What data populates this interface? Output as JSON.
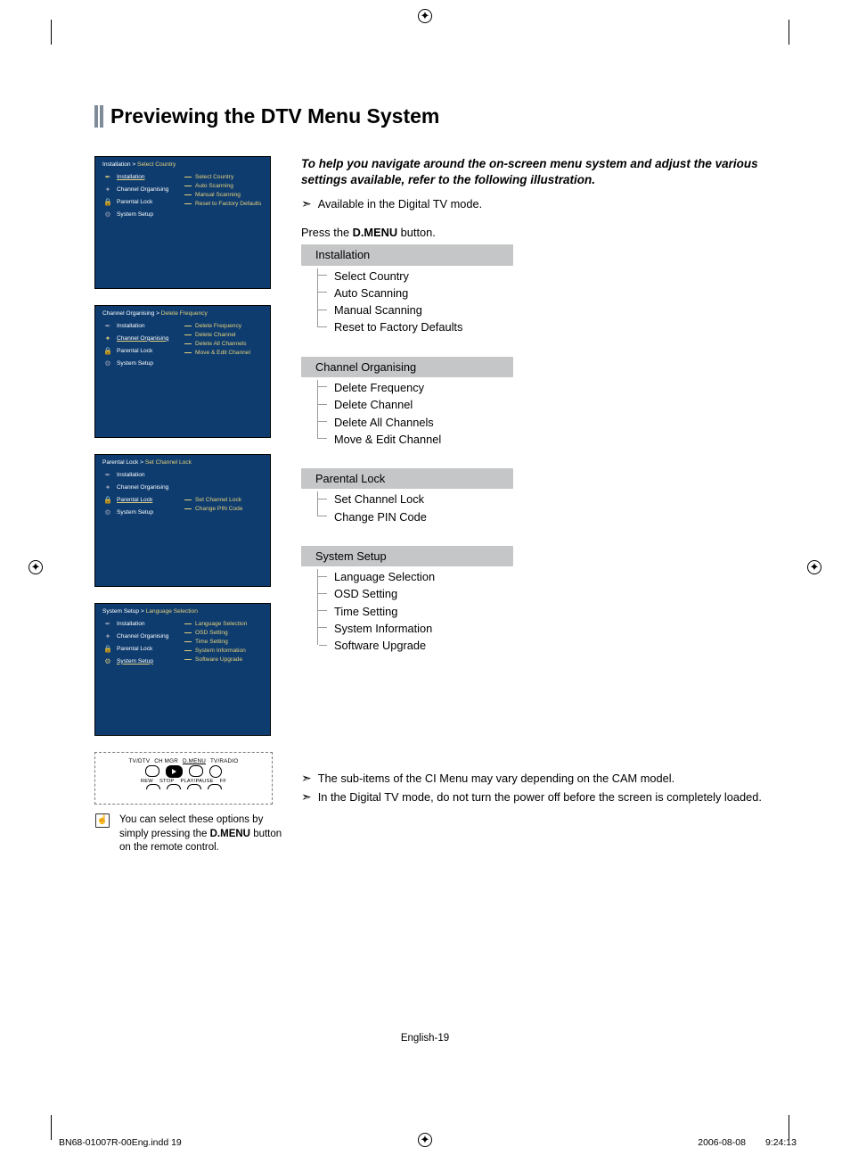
{
  "page_title": "Previewing the DTV Menu System",
  "intro": "To help you navigate around the on-screen menu system and adjust the various settings available, refer to the following illustration.",
  "note_available": "Available in the Digital TV mode.",
  "press_pre": "Press the ",
  "press_button": "D.MENU",
  "press_post": " button.",
  "menu": {
    "items": [
      {
        "label": "Installation",
        "subs": [
          "Select Country",
          "Auto Scanning",
          "Manual Scanning",
          "Reset to Factory Defaults"
        ]
      },
      {
        "label": "Channel Organising",
        "subs": [
          "Delete Frequency",
          "Delete Channel",
          "Delete All Channels",
          "Move & Edit Channel"
        ]
      },
      {
        "label": "Parental Lock",
        "subs": [
          "Set Channel Lock",
          "Change PIN Code"
        ]
      },
      {
        "label": "System Setup",
        "subs": [
          "Language Selection",
          "OSD Setting",
          "Time Setting",
          "System Information",
          "Software Upgrade"
        ]
      }
    ]
  },
  "panels": [
    {
      "bc_a": "Installation",
      "bc_b": "Select Country",
      "sel_index": 0,
      "sub_start": 0
    },
    {
      "bc_a": "Channel Organising",
      "bc_b": "Delete Frequency",
      "sel_index": 1,
      "sub_start": 0
    },
    {
      "bc_a": "Parental Lock",
      "bc_b": "Set Channel Lock",
      "sel_index": 2,
      "sub_start": 2
    },
    {
      "bc_a": "System Setup",
      "bc_b": "Language Selection",
      "sel_index": 3,
      "sub_start": 0
    }
  ],
  "menu_icons": [
    "✒",
    "✦",
    "🔒",
    "⚙"
  ],
  "bottom_notes": [
    "The sub-items of the CI Menu may vary depending on the CAM model.",
    "In the Digital TV mode, do not turn the power off before the screen is completely loaded."
  ],
  "remote": {
    "top_labels": [
      "TV/DTV",
      "CH MGR",
      "D.MENU",
      "TV/RADIO"
    ],
    "bot_labels": [
      "REW",
      "STOP",
      "PLAY/PAUSE",
      "FF"
    ]
  },
  "tip_pre": "You can select these options by simply pressing the ",
  "tip_btn": "D.MENU",
  "tip_post": " button on the remote control.",
  "footer_page": "English-19",
  "footer_file": "BN68-01007R-00Eng.indd   19",
  "footer_date": "2006-08-08",
  "footer_time": "9:24:13"
}
